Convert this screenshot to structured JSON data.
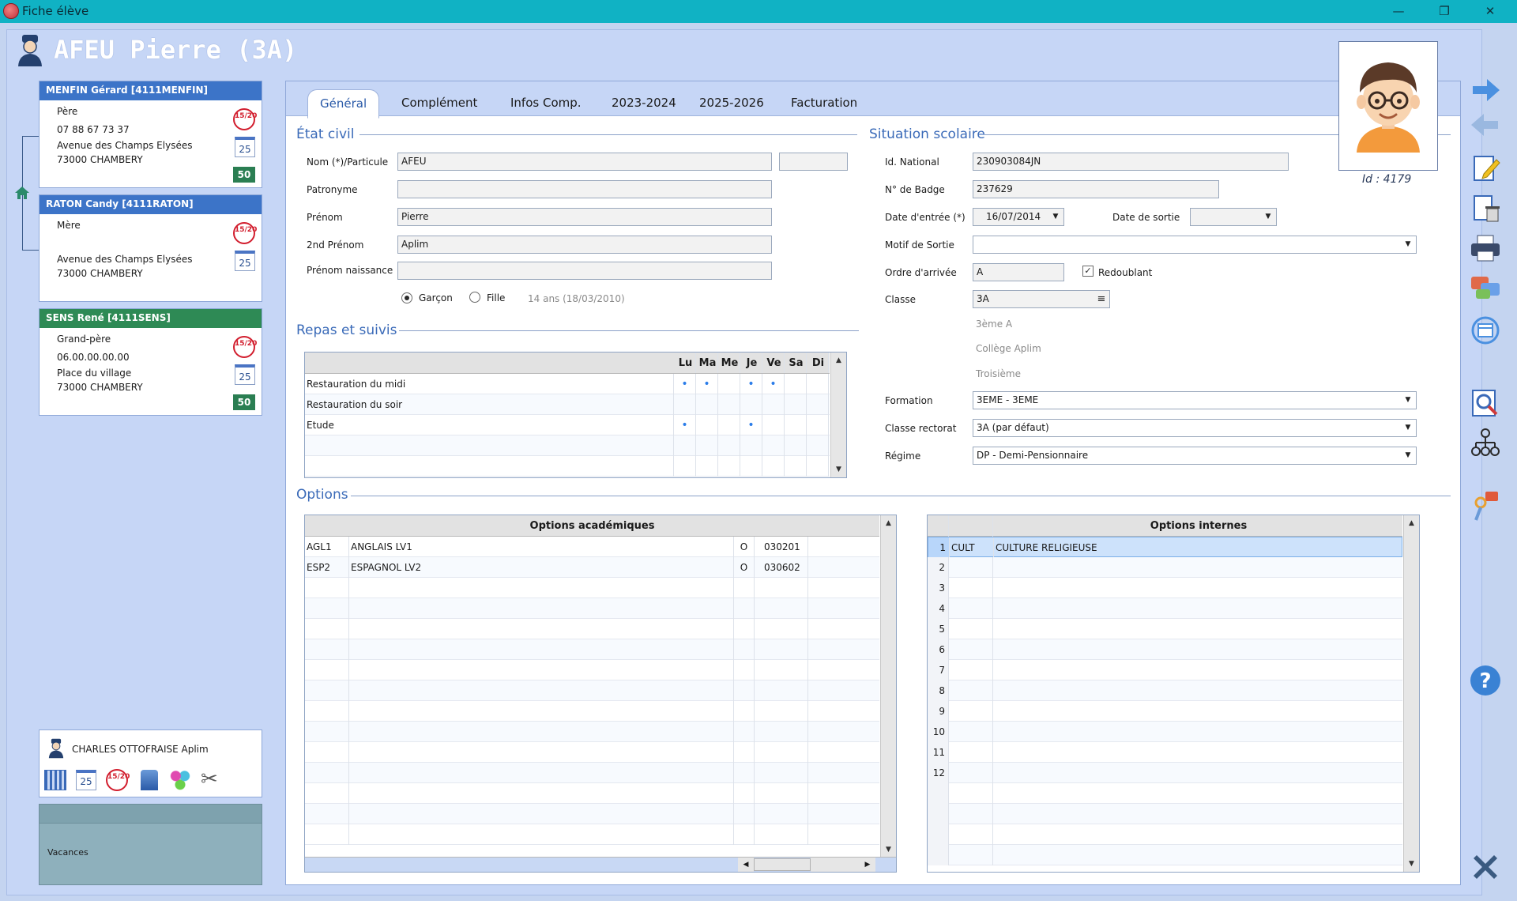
{
  "window": {
    "title": "Fiche élève",
    "minimize": "—",
    "restore": "❐",
    "close": "✕"
  },
  "header": {
    "student_name": "AFEU Pierre (3A)",
    "id_label": "Id : 4179"
  },
  "contacts": [
    {
      "header": "MENFIN Gérard [4111MENFIN]",
      "relation": "Père",
      "phone": "07 88 67 73 37",
      "address1": "Avenue des Champs Elysées",
      "address2": "73000 CHAMBERY",
      "color": "#3c74c8",
      "icon20": "15/20",
      "icon25": "25",
      "icon50": "50"
    },
    {
      "header": "RATON Candy [4111RATON]",
      "relation": "Mère",
      "phone": "",
      "address1": "Avenue des Champs Elysées",
      "address2": "73000 CHAMBERY",
      "color": "#3c74c8",
      "icon20": "15/20",
      "icon25": "25"
    },
    {
      "header": "SENS René [4111SENS]",
      "relation": "Grand-père",
      "phone": "06.00.00.00.00",
      "address1": "Place du village",
      "address2": "73000 CHAMBERY",
      "color": "#2e8a55",
      "icon20": "15/20",
      "icon25": "25",
      "icon50": "50"
    }
  ],
  "user_panel": {
    "name": "CHARLES OTTOFRAISE Aplim",
    "calendar_day": "25",
    "note_icon": "15/20"
  },
  "vacances": {
    "label": "Vacances"
  },
  "tabs": [
    "Général",
    "Complément",
    "Infos Comp.",
    "2023-2024",
    "2025-2026",
    "Facturation"
  ],
  "etat_civil": {
    "title": "État civil",
    "nom_label": "Nom (*)/Particule",
    "nom_value": "AFEU",
    "particule_value": "",
    "patronyme_label": "Patronyme",
    "patronyme_value": "",
    "prenom_label": "Prénom",
    "prenom_value": "Pierre",
    "prenom2_label": "2nd Prénom",
    "prenom2_value": "Aplim",
    "prenom_naissance_label": "Prénom naissance",
    "prenom_naissance_value": "",
    "garcon": "Garçon",
    "fille": "Fille",
    "age": "14 ans (18/03/2010)",
    "sexe_selected": "Garçon"
  },
  "situation": {
    "title": "Situation scolaire",
    "id_national_label": "Id. National",
    "id_national_value": "230903084JN",
    "badge_label": "N° de Badge",
    "badge_value": "237629",
    "date_entree_label": "Date d'entrée (*)",
    "date_entree_value": "16/07/2014",
    "date_sortie_label": "Date de sortie",
    "date_sortie_value": "",
    "motif_label": "Motif de Sortie",
    "motif_value": "",
    "ordre_label": "Ordre d'arrivée",
    "ordre_value": "A",
    "redoublant_label": "Redoublant",
    "redoublant_checked": true,
    "classe_label": "Classe",
    "classe_value": "3A",
    "classe_info1": "3ème A",
    "classe_info2": "Collège Aplim",
    "classe_info3": "Troisième",
    "formation_label": "Formation",
    "formation_value": "3EME - 3EME",
    "rectorat_label": "Classe rectorat",
    "rectorat_value": "3A (par défaut)",
    "regime_label": "Régime",
    "regime_value": "DP - Demi-Pensionnaire"
  },
  "repas": {
    "title": "Repas et suivis",
    "days": [
      "Lu",
      "Ma",
      "Me",
      "Je",
      "Ve",
      "Sa",
      "Di"
    ],
    "rows": [
      {
        "label": "Restauration du midi",
        "marks": [
          1,
          1,
          0,
          1,
          1,
          0,
          0
        ]
      },
      {
        "label": "Restauration du soir",
        "marks": [
          0,
          0,
          0,
          0,
          0,
          0,
          0
        ]
      },
      {
        "label": "Etude",
        "marks": [
          1,
          0,
          0,
          1,
          0,
          0,
          0
        ]
      },
      {
        "label": "",
        "marks": [
          0,
          0,
          0,
          0,
          0,
          0,
          0
        ]
      },
      {
        "label": "",
        "marks": [
          0,
          0,
          0,
          0,
          0,
          0,
          0
        ]
      }
    ],
    "mark_glyph": "•"
  },
  "options": {
    "title": "Options",
    "acad_header": "Options académiques",
    "acad_rows": [
      {
        "code": "AGL1",
        "label": "ANGLAIS LV1",
        "o": "O",
        "num": "030201"
      },
      {
        "code": "ESP2",
        "label": "ESPAGNOL LV2",
        "o": "O",
        "num": "030602"
      }
    ],
    "int_header": "Options internes",
    "int_rows": [
      {
        "n": "1",
        "code": "CULT",
        "label": "CULTURE RELIGIEUSE"
      },
      {
        "n": "2",
        "code": "",
        "label": ""
      },
      {
        "n": "3",
        "code": "",
        "label": ""
      },
      {
        "n": "4",
        "code": "",
        "label": ""
      },
      {
        "n": "5",
        "code": "",
        "label": ""
      },
      {
        "n": "6",
        "code": "",
        "label": ""
      },
      {
        "n": "7",
        "code": "",
        "label": ""
      },
      {
        "n": "8",
        "code": "",
        "label": ""
      },
      {
        "n": "9",
        "code": "",
        "label": ""
      },
      {
        "n": "10",
        "code": "",
        "label": ""
      },
      {
        "n": "11",
        "code": "",
        "label": ""
      },
      {
        "n": "12",
        "code": "",
        "label": ""
      }
    ]
  },
  "colors": {
    "titlebar": "#10b2c4",
    "accent": "#3c74c8",
    "green": "#2e8a55"
  }
}
